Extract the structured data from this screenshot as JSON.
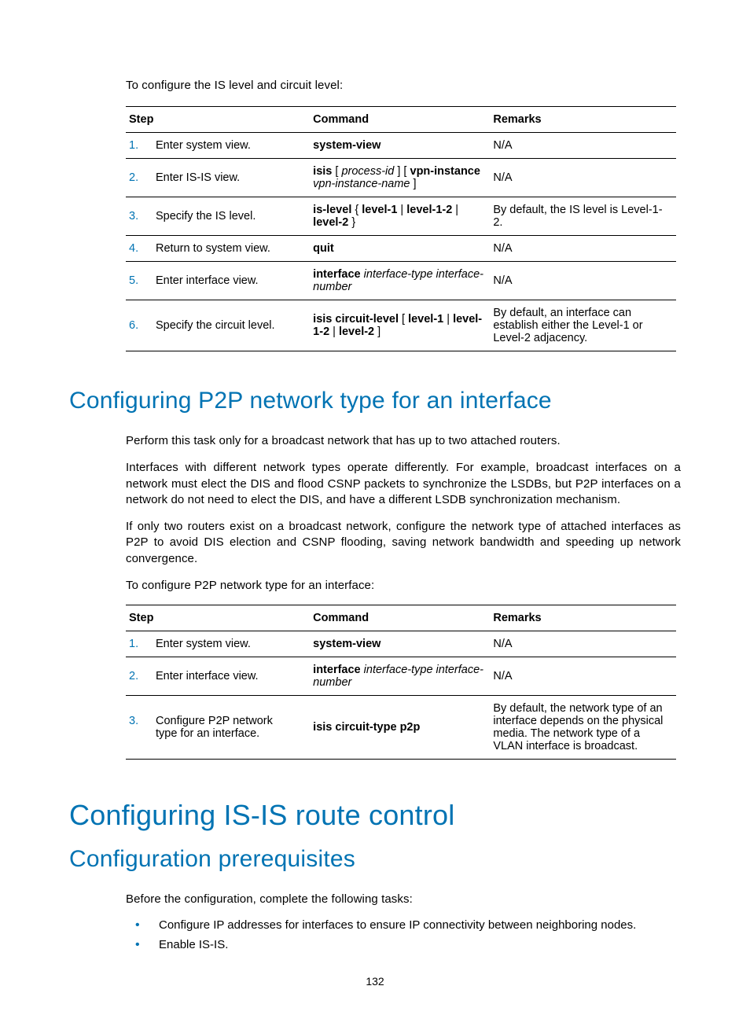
{
  "intro1": "To configure the IS level and circuit level:",
  "table1": {
    "headers": {
      "step": "Step",
      "command": "Command",
      "remarks": "Remarks"
    },
    "rows": [
      {
        "num": "1.",
        "desc": "Enter system view.",
        "cmd_bold": "system-view",
        "cmd_rest": "",
        "remarks": "N/A"
      },
      {
        "num": "2.",
        "desc": "Enter IS-IS view.",
        "cmd_html": "<span class='cmd-strong'>isis</span> [ <span class='cmd-italic'>process-id</span> ] [ <span class='cmd-strong'>vpn-instance</span> <span class='cmd-italic'>vpn-instance-name</span> ]",
        "remarks": "N/A"
      },
      {
        "num": "3.",
        "desc": "Specify the IS level.",
        "cmd_html": "<span class='cmd-strong'>is-level</span> { <span class='cmd-strong'>level-1</span> | <span class='cmd-strong'>level-1-2</span> | <span class='cmd-strong'>level-2</span> }",
        "remarks": "By default, the IS level is Level-1-2."
      },
      {
        "num": "4.",
        "desc": "Return to system view.",
        "cmd_bold": "quit",
        "cmd_rest": "",
        "remarks": "N/A"
      },
      {
        "num": "5.",
        "desc": "Enter interface view.",
        "cmd_html": "<span class='cmd-strong'>interface</span> <span class='cmd-italic'>interface-type interface-number</span>",
        "remarks": "N/A"
      },
      {
        "num": "6.",
        "desc": "Specify the circuit level.",
        "cmd_html": "<span class='cmd-strong'>isis circuit-level</span> [ <span class='cmd-strong'>level-1</span> | <span class='cmd-strong'>level-1-2</span> | <span class='cmd-strong'>level-2</span> ]",
        "remarks": "By default, an interface can establish either the Level-1 or Level-2 adjacency."
      }
    ]
  },
  "heading_p2p": "Configuring P2P network type for an interface",
  "p2p_paras": [
    "Perform this task only for a broadcast network that has up to two attached routers.",
    "Interfaces with different network types operate differently. For example, broadcast interfaces on a network must elect the DIS and flood CSNP packets to synchronize the LSDBs, but P2P interfaces on a network do not need to elect the DIS, and have a different LSDB synchronization mechanism.",
    "If only two routers exist on a broadcast network, configure the network type of attached interfaces as P2P to avoid DIS election and CSNP flooding, saving network bandwidth and speeding up network convergence.",
    "To configure P2P network type for an interface:"
  ],
  "table2": {
    "headers": {
      "step": "Step",
      "command": "Command",
      "remarks": "Remarks"
    },
    "rows": [
      {
        "num": "1.",
        "desc": "Enter system view.",
        "cmd_bold": "system-view",
        "cmd_rest": "",
        "remarks": "N/A"
      },
      {
        "num": "2.",
        "desc": "Enter interface view.",
        "cmd_html": "<span class='cmd-strong'>interface</span> <span class='cmd-italic'>interface-type interface-number</span>",
        "remarks": "N/A"
      },
      {
        "num": "3.",
        "desc": "Configure P2P network type for an interface.",
        "cmd_bold": "isis circuit-type p2p",
        "cmd_rest": "",
        "remarks": "By default, the network type of an interface depends on the physical media. The network type of a VLAN interface is broadcast."
      }
    ]
  },
  "heading_routectrl": "Configuring IS-IS route control",
  "heading_prereq": "Configuration prerequisites",
  "prereq_intro": "Before the configuration, complete the following tasks:",
  "bullets": [
    "Configure IP addresses for interfaces to ensure IP connectivity between neighboring nodes.",
    "Enable IS-IS."
  ],
  "page_number": "132"
}
